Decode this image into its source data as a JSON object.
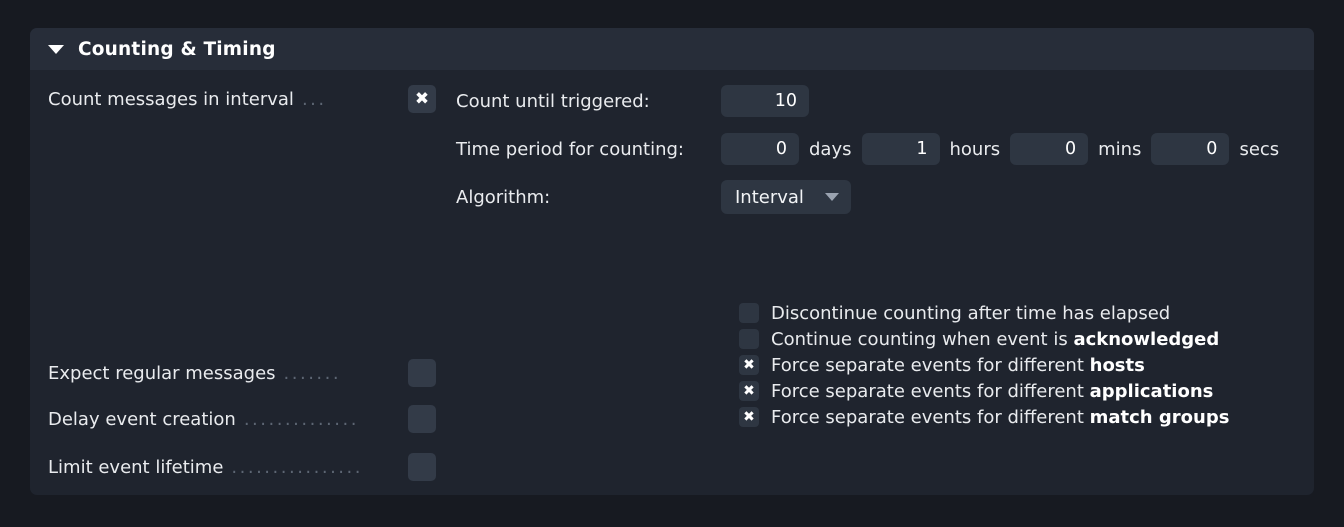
{
  "panel": {
    "title": "Counting & Timing",
    "collapse_icon": "triangle-down-icon",
    "expanded": true
  },
  "left_options": [
    {
      "label": "Count messages in interval",
      "leader": "...",
      "checked": true,
      "mark": "✖",
      "name": "count-messages-in-interval"
    },
    {
      "label": "Expect regular messages",
      "leader": ".......",
      "checked": false,
      "mark": "",
      "name": "expect-regular-messages"
    },
    {
      "label": "Delay event creation",
      "leader": "..............",
      "checked": false,
      "mark": "",
      "name": "delay-event-creation"
    },
    {
      "label": "Limit event lifetime",
      "leader": "................",
      "checked": false,
      "mark": "",
      "name": "limit-event-lifetime"
    }
  ],
  "fields": {
    "count_until_triggered_label": "Count until triggered:",
    "count_until_triggered_value": "10",
    "time_period_label": "Time period for counting:",
    "time_days_value": "0",
    "time_days_unit": "days",
    "time_hours_value": "1",
    "time_hours_unit": "hours",
    "time_mins_value": "0",
    "time_mins_unit": "mins",
    "time_secs_value": "0",
    "time_secs_unit": "secs",
    "algorithm_label": "Algorithm:",
    "algorithm_value": "Interval",
    "algorithm_caret": "chevron-down-icon"
  },
  "checkboxes": [
    {
      "text_plain": "Discontinue counting after time has elapsed",
      "text_normal": "Discontinue counting after time has elapsed",
      "text_bold": "",
      "checked": false,
      "mark": "",
      "name": "discontinue-counting-after-time-elapsed"
    },
    {
      "text_plain": "Continue counting when event is acknowledged",
      "text_normal": "Continue counting when event is ",
      "text_bold": "acknowledged",
      "checked": false,
      "mark": "",
      "name": "continue-counting-when-acknowledged"
    },
    {
      "text_plain": "Force separate events for different hosts",
      "text_normal": "Force separate events for different ",
      "text_bold": "hosts",
      "checked": true,
      "mark": "✖",
      "name": "force-separate-events-hosts"
    },
    {
      "text_plain": "Force separate events for different applications",
      "text_normal": "Force separate events for different ",
      "text_bold": "applications",
      "checked": true,
      "mark": "✖",
      "name": "force-separate-events-applications"
    },
    {
      "text_plain": "Force separate events for different match groups",
      "text_normal": "Force separate events for different ",
      "text_bold": "match groups",
      "checked": true,
      "mark": "✖",
      "name": "force-separate-events-match-groups"
    }
  ],
  "colors": {
    "page_bg": "#171a21",
    "panel_bg": "#1f242e",
    "panel_header_bg": "#272d39",
    "control_bg": "#2e3642",
    "toggle_bg": "#333b48",
    "text": "#e9ebee",
    "leader": "#5d6673"
  }
}
